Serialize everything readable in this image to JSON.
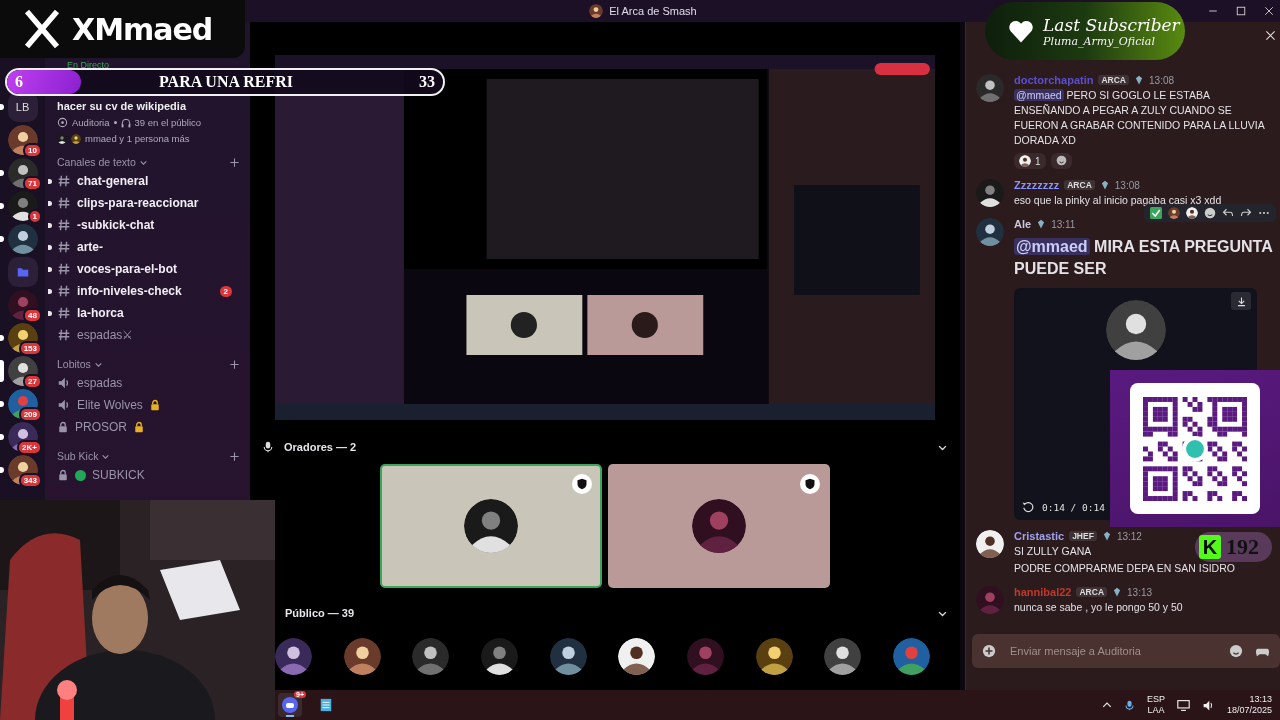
{
  "window": {
    "title": "El Arca de Smash"
  },
  "servers": [
    {
      "kind": "text",
      "label": "LB",
      "unread": true,
      "selected": false
    },
    {
      "kind": "avatar",
      "badge": "10",
      "unread": false,
      "selected": false
    },
    {
      "kind": "avatar",
      "badge": "71",
      "unread": true,
      "selected": false
    },
    {
      "kind": "avatar",
      "badge": "1",
      "unread": true,
      "selected": false
    },
    {
      "kind": "avatar",
      "unread": true,
      "selected": false
    },
    {
      "kind": "folder",
      "unread": false,
      "selected": false
    },
    {
      "kind": "avatar",
      "badge": "48",
      "unread": false,
      "selected": false
    },
    {
      "kind": "avatar",
      "badge": "153",
      "unread": true,
      "selected": false
    },
    {
      "kind": "avatar",
      "badge": "27",
      "unread": false,
      "selected": true
    },
    {
      "kind": "avatar",
      "badge": "209",
      "unread": true,
      "selected": false
    },
    {
      "kind": "avatar",
      "badge": "2K+",
      "unread": true,
      "selected": false
    },
    {
      "kind": "avatar",
      "badge": "343",
      "unread": true,
      "selected": false
    }
  ],
  "stage": {
    "status": "En Directo",
    "title": "hacer su cv de wikipedia",
    "channel": "Auditoria",
    "audience": "39 en el público",
    "members": "mmaed y 1 persona más"
  },
  "categories": [
    {
      "name": "Canales de texto",
      "channels": [
        {
          "kind": "text",
          "name": "chat-general",
          "unread": true
        },
        {
          "kind": "text",
          "name": "clips-para-reaccionar",
          "unread": true
        },
        {
          "kind": "text",
          "name": "-subkick-chat",
          "unread": true
        },
        {
          "kind": "text",
          "name": "arte-",
          "unread": true
        },
        {
          "kind": "text",
          "name": "voces-para-el-bot",
          "unread": true
        },
        {
          "kind": "text",
          "name": "info-niveles-check",
          "unread": true,
          "badge": "2"
        },
        {
          "kind": "text",
          "name": "la-horca",
          "unread": true
        },
        {
          "kind": "text",
          "name": "espadas⚔",
          "unread": false
        }
      ]
    },
    {
      "name": "Lobitos",
      "channels": [
        {
          "kind": "voice",
          "name": "espadas",
          "unread": false
        },
        {
          "kind": "voice",
          "name": "Elite Wolves",
          "unread": false,
          "locked": true
        },
        {
          "kind": "locked",
          "name": "PROSOR",
          "unread": false,
          "locked": true
        }
      ]
    },
    {
      "name": "Sub Kick",
      "channels": [
        {
          "kind": "locked",
          "name": "SUBKICK",
          "unread": false,
          "color": "#23a55a"
        }
      ]
    }
  ],
  "speakers": {
    "heading": "Oradores — 2",
    "items": [
      {
        "speaking": true,
        "color": "#c9c5b8"
      },
      {
        "speaking": false,
        "color": "#b99a98"
      }
    ]
  },
  "audience": {
    "heading": "Público — 39"
  },
  "chat": {
    "messages": [
      {
        "kind": "text",
        "author": "doctorchapatin",
        "color": "#5b4fd0",
        "tag": "ARCA",
        "time": "13:08",
        "mention": "@mmaed",
        "text": "PERO SI GOGLO LE ESTABA ENSEÑANDO A PEGAR A ZULY CUANDO SE FUERON A GRABAR CONTENIDO PARA LA LLUVIA DORADA XD",
        "reactions": [
          {
            "count": "1"
          }
        ]
      },
      {
        "kind": "text",
        "author": "Zzzzzzzz",
        "color": "#8a94ff",
        "tag": "ARCA",
        "time": "13:08",
        "text": "eso que la pinky al inicio pagaba casi x3 xdd"
      },
      {
        "kind": "large",
        "author": "Ale",
        "color": "#c8c8dc",
        "time": "13:11",
        "mention": "@mmaed",
        "text": "MIRA ESTA PREGUNTA PUEDE SER",
        "attachment": {
          "kind": "video",
          "time": "0:14 / 0:14"
        }
      },
      {
        "kind": "text",
        "author": "Cristastic",
        "color": "#a0a4f0",
        "tag": "JHEF",
        "time": "13:12",
        "text": "SI ZULLY GANA",
        "text2": "PODRE COMPRARME DEPA EN SAN ISIDRO"
      },
      {
        "kind": "text",
        "author": "hannibal22",
        "color": "#c0392b",
        "tag": "ARCA",
        "time": "13:13",
        "text": "nunca se sabe , yo le pongo 50 y 50"
      }
    ],
    "placeholder": "Enviar mensaje a Auditoria"
  },
  "overlays": {
    "brand": "XMmaed",
    "goal": {
      "current": "6",
      "label": "PARA UNA REFRI",
      "target": "33",
      "level": 0.17
    },
    "last_subscriber": {
      "title": "Last Subscriber",
      "name": "Pluma_Army_Oficial"
    },
    "kick": {
      "logo": "K",
      "count": "192"
    }
  },
  "taskbar": {
    "apps": [
      {
        "kind": "discord",
        "badge": "9+",
        "selected": true
      },
      {
        "kind": "notepad",
        "selected": false
      }
    ],
    "language": [
      "ESP",
      "LAA"
    ],
    "time": "13:13",
    "date": "18/07/2025"
  }
}
